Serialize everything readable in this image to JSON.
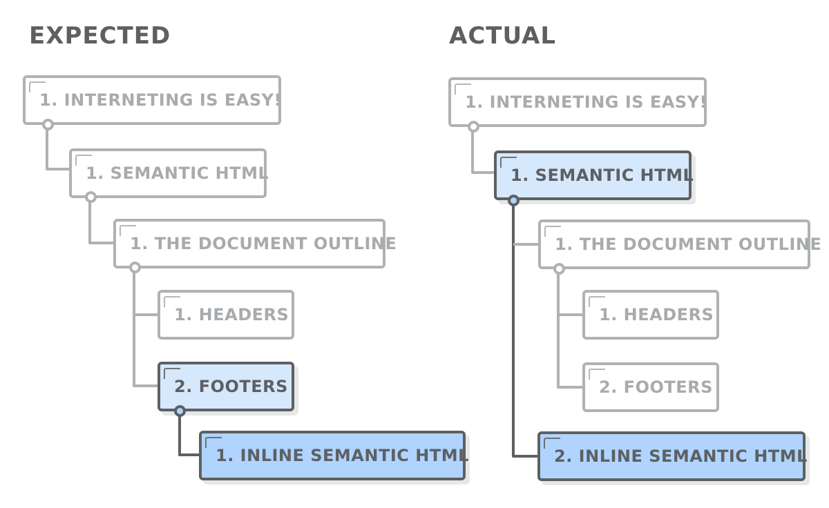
{
  "expected": {
    "title": "EXPECTED",
    "nodes": [
      {
        "label": "1. INTERNETING IS EASY!",
        "state": "inactive"
      },
      {
        "label": "1. SEMANTIC HTML",
        "state": "inactive"
      },
      {
        "label": "1. THE DOCUMENT OUTLINE",
        "state": "inactive"
      },
      {
        "label": "1. HEADERS",
        "state": "inactive"
      },
      {
        "label": "2. FOOTERS",
        "state": "parent-highlight"
      },
      {
        "label": "1. INLINE SEMANTIC HTML",
        "state": "highlight"
      }
    ]
  },
  "actual": {
    "title": "ACTUAL",
    "nodes": [
      {
        "label": "1. INTERNETING IS EASY!",
        "state": "inactive"
      },
      {
        "label": "1. SEMANTIC HTML",
        "state": "parent-highlight"
      },
      {
        "label": "1. THE DOCUMENT OUTLINE",
        "state": "inactive"
      },
      {
        "label": "1. HEADERS",
        "state": "inactive"
      },
      {
        "label": "2. FOOTERS",
        "state": "inactive"
      },
      {
        "label": "2. INLINE SEMANTIC HTML",
        "state": "highlight"
      }
    ]
  },
  "colors": {
    "inactive_border": "#afb1b3",
    "active_border": "#5d6063",
    "parent_fill": "#d6e8fc",
    "highlight_fill": "#b0d4fd"
  }
}
